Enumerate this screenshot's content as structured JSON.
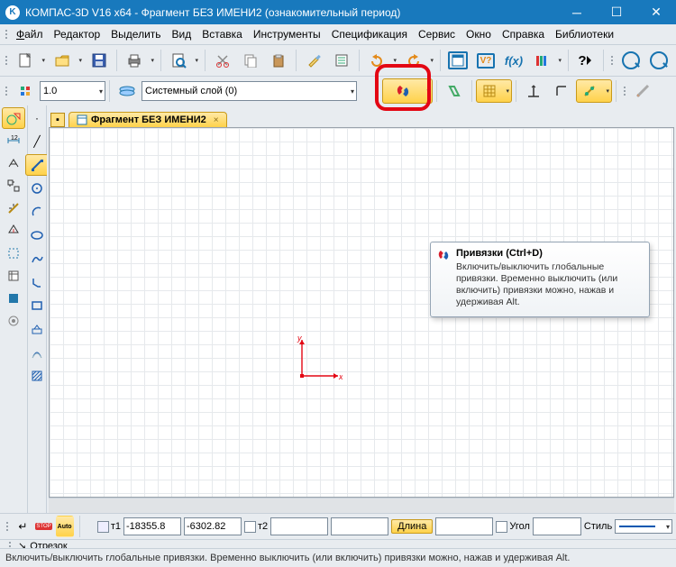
{
  "window": {
    "title": "КОМПАС-3D V16  x64 - Фрагмент БЕЗ ИМЕНИ2 (ознакомительный период)",
    "app_icon_letter": "K"
  },
  "menu": {
    "file": "Файл",
    "edit": "Редактор",
    "select": "Выделить",
    "view": "Вид",
    "insert": "Вставка",
    "tools": "Инструменты",
    "spec": "Спецификация",
    "service": "Сервис",
    "window": "Окно",
    "help": "Справка",
    "libs": "Библиотеки"
  },
  "row2": {
    "scale": "1.0",
    "layer": "Системный слой (0)"
  },
  "tab": {
    "label": "Фрагмент БЕЗ ИМЕНИ2"
  },
  "tooltip": {
    "title": "Привязки (Ctrl+D)",
    "body": "Включить/выключить глобальные привязки. Временно выключить (или включить) привязки можно, нажав и удерживая Alt."
  },
  "axes": {
    "x": "x",
    "y": "y"
  },
  "props": {
    "t1": "т1",
    "x": "-18355.8",
    "y": "-6302.82",
    "t2": "т2",
    "length_label": "Длина",
    "angle_label": "Угол",
    "style_label": "Стиль"
  },
  "cmd": {
    "arrow": "↘",
    "label": "Отрезок"
  },
  "status": {
    "text": "Включить/выключить глобальные привязки. Временно выключить (или включить) привязки можно, нажав и удерживая Alt."
  },
  "icons": {
    "stop": "STOP",
    "auto": "Auto"
  }
}
